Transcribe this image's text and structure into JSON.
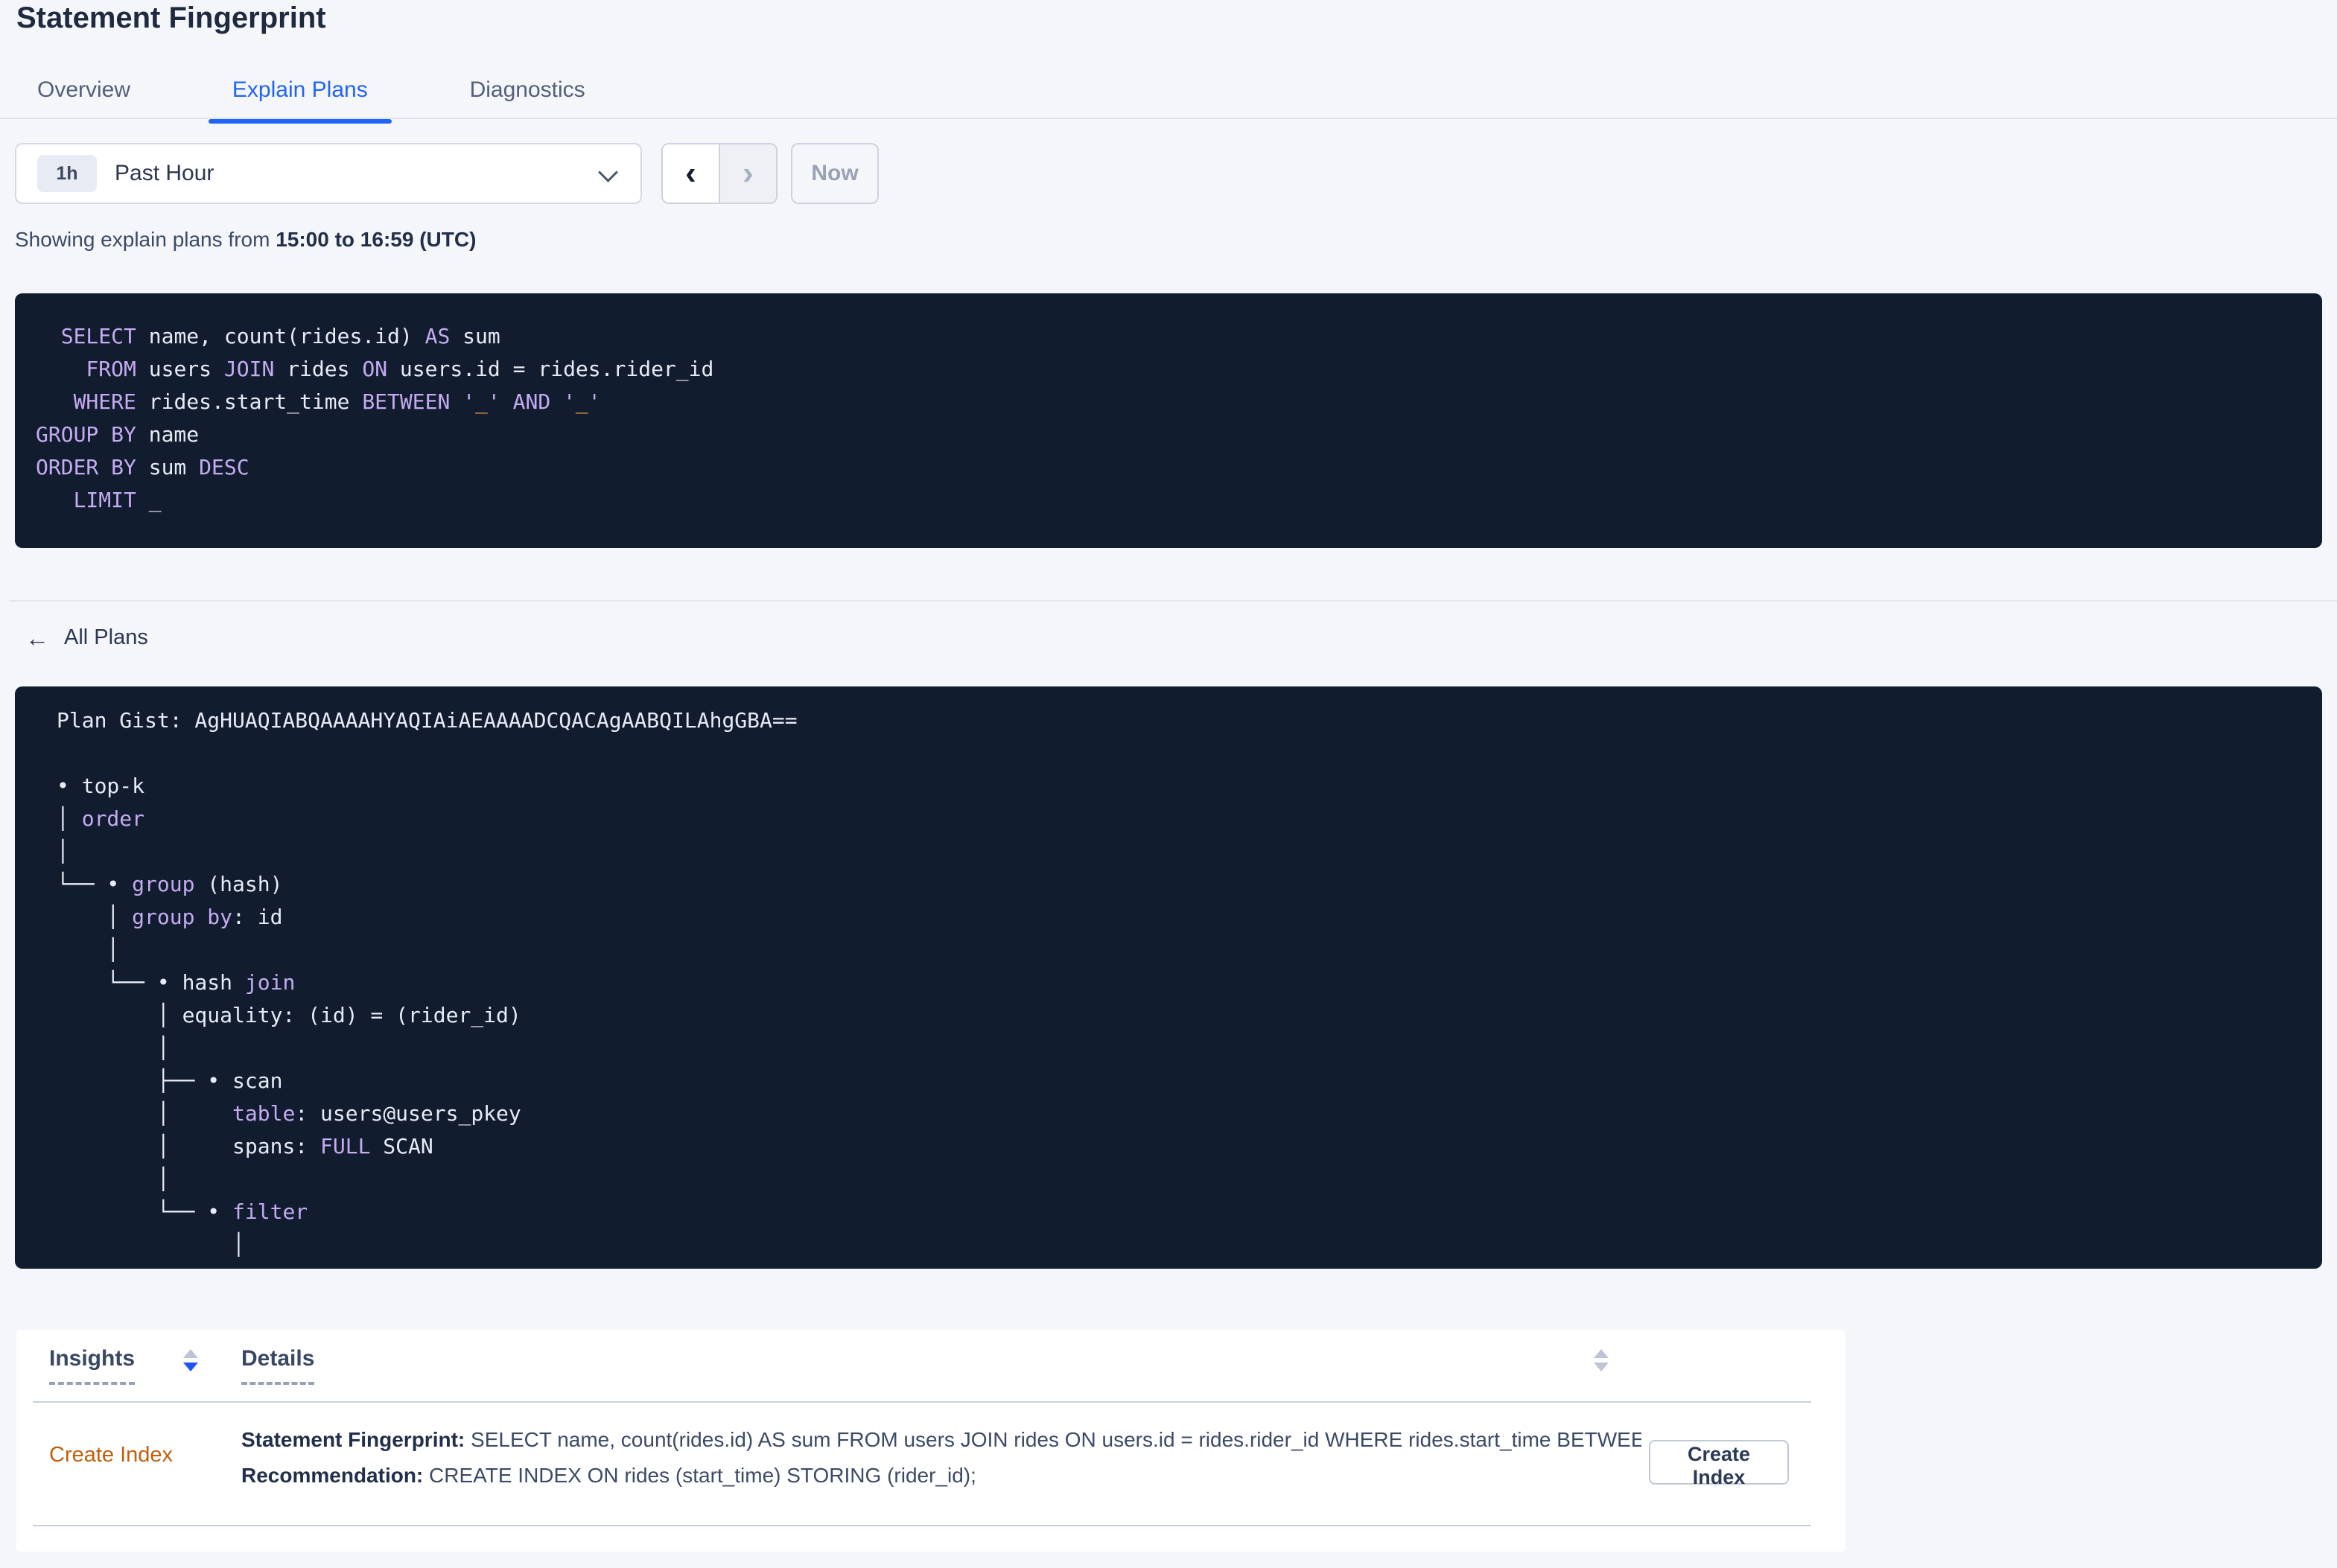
{
  "page": {
    "title": "Statement Fingerprint"
  },
  "tabs": [
    {
      "label": "Overview",
      "active": false
    },
    {
      "label": "Explain Plans",
      "active": true
    },
    {
      "label": "Diagnostics",
      "active": false
    }
  ],
  "time_picker": {
    "badge": "1h",
    "label": "Past Hour",
    "now_label": "Now"
  },
  "icons": {
    "chevron_left": "‹",
    "chevron_right": "›",
    "arrow_left": "←"
  },
  "showing": {
    "prefix": "Showing explain plans from ",
    "range_bold": "15:00 to 16:59 (UTC)"
  },
  "sql": {
    "lines": [
      [
        [
          "w",
          "  "
        ],
        [
          "k",
          "SELECT"
        ],
        [
          "w",
          " name, count(rides.id) "
        ],
        [
          "k",
          "AS"
        ],
        [
          "w",
          " sum"
        ]
      ],
      [
        [
          "w",
          "    "
        ],
        [
          "k",
          "FROM"
        ],
        [
          "w",
          " users "
        ],
        [
          "k",
          "JOIN"
        ],
        [
          "w",
          " rides "
        ],
        [
          "k",
          "ON"
        ],
        [
          "w",
          " users.id = rides.rider_id"
        ]
      ],
      [
        [
          "w",
          "   "
        ],
        [
          "k",
          "WHERE"
        ],
        [
          "w",
          " rides.start_time "
        ],
        [
          "k",
          "BETWEEN"
        ],
        [
          "w",
          " "
        ],
        [
          "k",
          "'"
        ],
        [
          "o",
          "_"
        ],
        [
          "k",
          "'"
        ],
        [
          "w",
          " "
        ],
        [
          "k",
          "AND"
        ],
        [
          "w",
          " "
        ],
        [
          "k",
          "'"
        ],
        [
          "o",
          "_"
        ],
        [
          "k",
          "'"
        ]
      ],
      [
        [
          "k",
          "GROUP BY"
        ],
        [
          "w",
          " name"
        ]
      ],
      [
        [
          "k",
          "ORDER BY"
        ],
        [
          "w",
          " sum "
        ],
        [
          "k",
          "DESC"
        ]
      ],
      [
        [
          "w",
          "   "
        ],
        [
          "k",
          "LIMIT"
        ],
        [
          "w",
          " _"
        ]
      ]
    ]
  },
  "all_plans": {
    "label": "All Plans"
  },
  "plan_gist": {
    "lines": [
      [
        [
          "w",
          "Plan Gist: AgHUAQIABQAAAAHYAQIAiAEAAAADCQACAgAABQILAhgGBA=="
        ]
      ],
      [],
      [
        [
          "w",
          "• top-k"
        ]
      ],
      [
        [
          "w",
          "│ "
        ],
        [
          "k",
          "order"
        ]
      ],
      [
        [
          "w",
          "│"
        ]
      ],
      [
        [
          "w",
          "└── • "
        ],
        [
          "k",
          "group"
        ],
        [
          "w",
          " (hash)"
        ]
      ],
      [
        [
          "w",
          "    │ "
        ],
        [
          "k",
          "group by"
        ],
        [
          "w",
          ": id"
        ]
      ],
      [
        [
          "w",
          "    │"
        ]
      ],
      [
        [
          "w",
          "    └── • hash "
        ],
        [
          "k",
          "join"
        ]
      ],
      [
        [
          "w",
          "        │ equality: (id) = (rider_id)"
        ]
      ],
      [
        [
          "w",
          "        │"
        ]
      ],
      [
        [
          "w",
          "        ├── • scan"
        ]
      ],
      [
        [
          "w",
          "        │     "
        ],
        [
          "k",
          "table"
        ],
        [
          "w",
          ": users@users_pkey"
        ]
      ],
      [
        [
          "w",
          "        │     spans: "
        ],
        [
          "k",
          "FULL"
        ],
        [
          "w",
          " SCAN"
        ]
      ],
      [
        [
          "w",
          "        │"
        ]
      ],
      [
        [
          "w",
          "        └── • "
        ],
        [
          "k",
          "filter"
        ]
      ],
      [
        [
          "w",
          "              │"
        ]
      ]
    ]
  },
  "insights_table": {
    "headers": [
      {
        "label": "Insights",
        "sort": "desc"
      },
      {
        "label": "Details",
        "sort": "none"
      }
    ],
    "rows": [
      {
        "insight_link": "Create Index",
        "fingerprint_label": "Statement Fingerprint:",
        "fingerprint_text": " SELECT name, count(rides.id) AS sum FROM users JOIN rides ON users.id = rides.rider_id WHERE rides.start_time BETWEEN '_...",
        "recommendation_label": "Recommendation:",
        "recommendation_text": " CREATE INDEX ON rides (start_time) STORING (rider_id);",
        "action_button": "Create Index"
      }
    ]
  },
  "colors": {
    "page_background": "#f5f6fa",
    "accent_blue": "#2264f7",
    "panel_dark": "#111c2e",
    "code_keyword_purple": "#c5abf2",
    "code_text": "#e7ebf6",
    "code_literal_orange": "#ffa23e",
    "insight_link_orange": "#bf600e",
    "sort_active_blue": "#1b55f5"
  }
}
